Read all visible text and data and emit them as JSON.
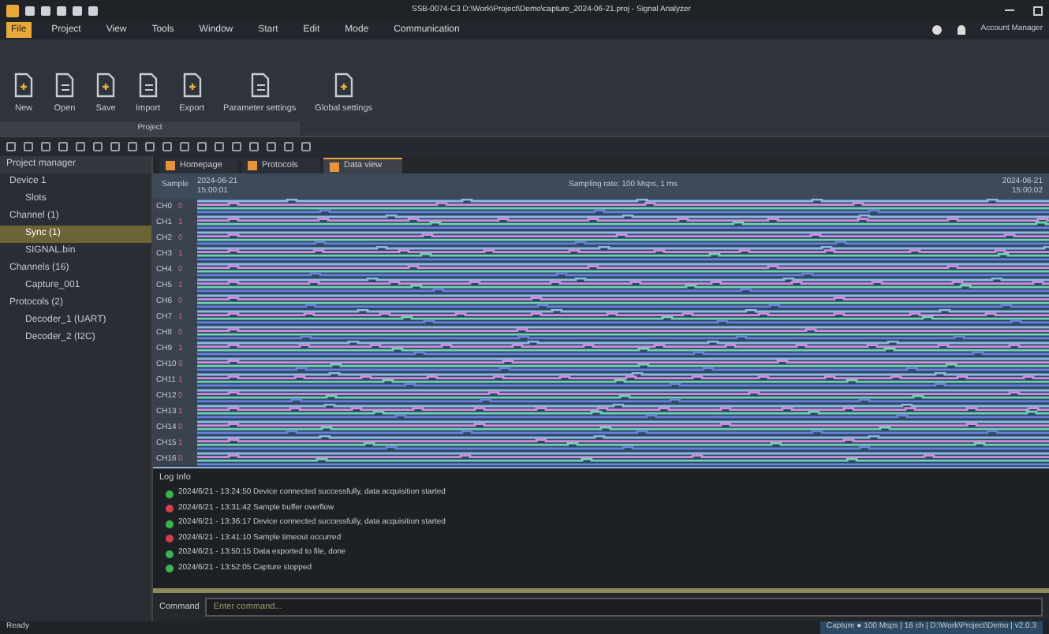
{
  "window": {
    "title": "SSB-0074-C3 D:\\Work\\Project\\Demo\\capture_2024-06-21.proj - Signal Analyzer"
  },
  "menu": [
    {
      "label": "File",
      "selected": true
    },
    {
      "label": "Project",
      "selected": false
    },
    {
      "label": "View",
      "selected": false
    },
    {
      "label": "Tools",
      "selected": false
    },
    {
      "label": "Window",
      "selected": false
    },
    {
      "label": "Start",
      "selected": false
    },
    {
      "label": "Edit",
      "selected": false
    },
    {
      "label": "Mode",
      "selected": false
    },
    {
      "label": "Communication",
      "selected": false
    }
  ],
  "account": "Account Manager",
  "ribbon": {
    "group": "Project",
    "buttons": [
      "New",
      "Open",
      "Save",
      "Import",
      "Export",
      "Parameter settings",
      "Global settings"
    ]
  },
  "sidebar": {
    "title": "Project manager",
    "items": [
      {
        "label": "Device 1",
        "selected": false,
        "children": [
          {
            "label": "Slots",
            "selected": false
          }
        ]
      },
      {
        "label": "Channel (1)",
        "selected": false,
        "children": [
          {
            "label": "Sync (1)",
            "selected": true
          },
          {
            "label": "SIGNAL.bin",
            "selected": false
          }
        ]
      },
      {
        "label": "Channels (16)",
        "selected": false,
        "children": [
          {
            "label": "Capture_001",
            "selected": false
          }
        ]
      },
      {
        "label": "Protocols (2)",
        "selected": false,
        "children": [
          {
            "label": "Decoder_1 (UART)",
            "selected": false
          },
          {
            "label": "Decoder_2 (I2C)",
            "selected": false
          }
        ]
      }
    ]
  },
  "tabs": [
    {
      "label": "Homepage",
      "selected": false
    },
    {
      "label": "Protocols",
      "selected": false
    },
    {
      "label": "Data view",
      "selected": true
    }
  ],
  "wave": {
    "column_1": "Sample",
    "time_start": "2024-06-21 15:00:01",
    "caption": "Sampling rate: 100 Msps, 1 ms",
    "time_end": "2024-06-21 15:00:02",
    "channels": [
      {
        "name": "CH0",
        "value": "0"
      },
      {
        "name": "CH1",
        "value": "1"
      },
      {
        "name": "CH2",
        "value": "0"
      },
      {
        "name": "CH3",
        "value": "1"
      },
      {
        "name": "CH4",
        "value": "0"
      },
      {
        "name": "CH5",
        "value": "1"
      },
      {
        "name": "CH6",
        "value": "0"
      },
      {
        "name": "CH7",
        "value": "1"
      },
      {
        "name": "CH8",
        "value": "0"
      },
      {
        "name": "CH9",
        "value": "1"
      },
      {
        "name": "CH10",
        "value": "0"
      },
      {
        "name": "CH11",
        "value": "1"
      },
      {
        "name": "CH12",
        "value": "0"
      },
      {
        "name": "CH13",
        "value": "1"
      },
      {
        "name": "CH14",
        "value": "0"
      },
      {
        "name": "CH15",
        "value": "1"
      },
      {
        "name": "CH16",
        "value": "0"
      }
    ]
  },
  "log": {
    "title": "Log Info",
    "entries": [
      {
        "kind": "ok",
        "text": "2024/6/21 - 13:24:50 Device connected successfully, data acquisition started"
      },
      {
        "kind": "error",
        "text": "2024/6/21 - 13:31:42 Sample buffer overflow"
      },
      {
        "kind": "ok",
        "text": "2024/6/21 - 13:36:17 Device connected successfully, data acquisition started"
      },
      {
        "kind": "error",
        "text": "2024/6/21 - 13:41:10 Sample timeout occurred"
      },
      {
        "kind": "ok",
        "text": "2024/6/21 - 13:50:15 Data exported to file, done"
      },
      {
        "kind": "ok",
        "text": "2024/6/21 - 13:52:05 Capture stopped"
      }
    ]
  },
  "command": {
    "label": "Command",
    "placeholder": "Enter command..."
  },
  "status_bar": {
    "left": "Ready",
    "right": "Capture  ●  100 Msps | 16 ch | D:\\Work\\Project\\Demo | v2.0.3"
  }
}
